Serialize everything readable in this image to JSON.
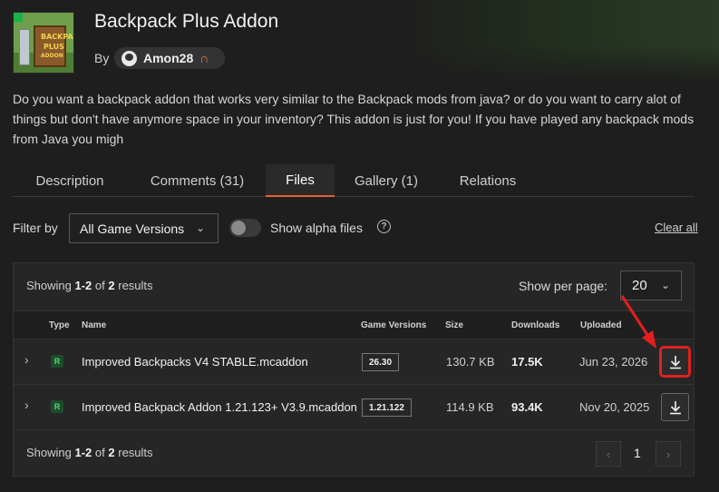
{
  "project": {
    "title": "Backpack Plus Addon",
    "by_label": "By",
    "author": "Amon28",
    "thumbnail_text": [
      "BACKPACK",
      "PLUS",
      "ADDON"
    ],
    "description": "Do you want a backpack addon that works very similar to the Backpack mods from java? or do you want to carry alot of things but don't have anymore space in your inventory? This addon is just for you! If you have played any backpack mods from Java you migh"
  },
  "tabs": [
    {
      "label": "Description"
    },
    {
      "label": "Comments (31)"
    },
    {
      "label": "Files",
      "active": true
    },
    {
      "label": "Gallery (1)"
    },
    {
      "label": "Relations"
    }
  ],
  "filter": {
    "label": "Filter by",
    "game_versions_selected": "All Game Versions",
    "alpha_label": "Show alpha files",
    "alpha_enabled": false,
    "clear_all": "Clear all"
  },
  "files": {
    "showing_prefix": "Showing",
    "showing_range": "1-2",
    "showing_of": "of",
    "showing_total": "2",
    "showing_suffix": "results",
    "per_page_label": "Show per page:",
    "per_page_value": "20",
    "columns": [
      "Type",
      "Name",
      "Game Versions",
      "Size",
      "Downloads",
      "Uploaded"
    ],
    "rows": [
      {
        "type": "R",
        "name": "Improved Backpacks V4 STABLE.mcaddon",
        "game_version": "26.30",
        "size": "130.7 KB",
        "downloads": "17.5K",
        "uploaded": "Jun 23, 2026"
      },
      {
        "type": "R",
        "name": "Improved Backpack Addon 1.21.123+ V3.9.mcaddon",
        "game_version": "1.21.122",
        "size": "114.9 KB",
        "downloads": "93.4K",
        "uploaded": "Nov 20, 2025"
      }
    ],
    "pagination": {
      "current_page": "1",
      "prev_icon": "‹",
      "next_icon": "›"
    }
  },
  "colors": {
    "accent": "#e5602f",
    "highlight": "#e02020",
    "release_badge": "#5fd17f"
  }
}
